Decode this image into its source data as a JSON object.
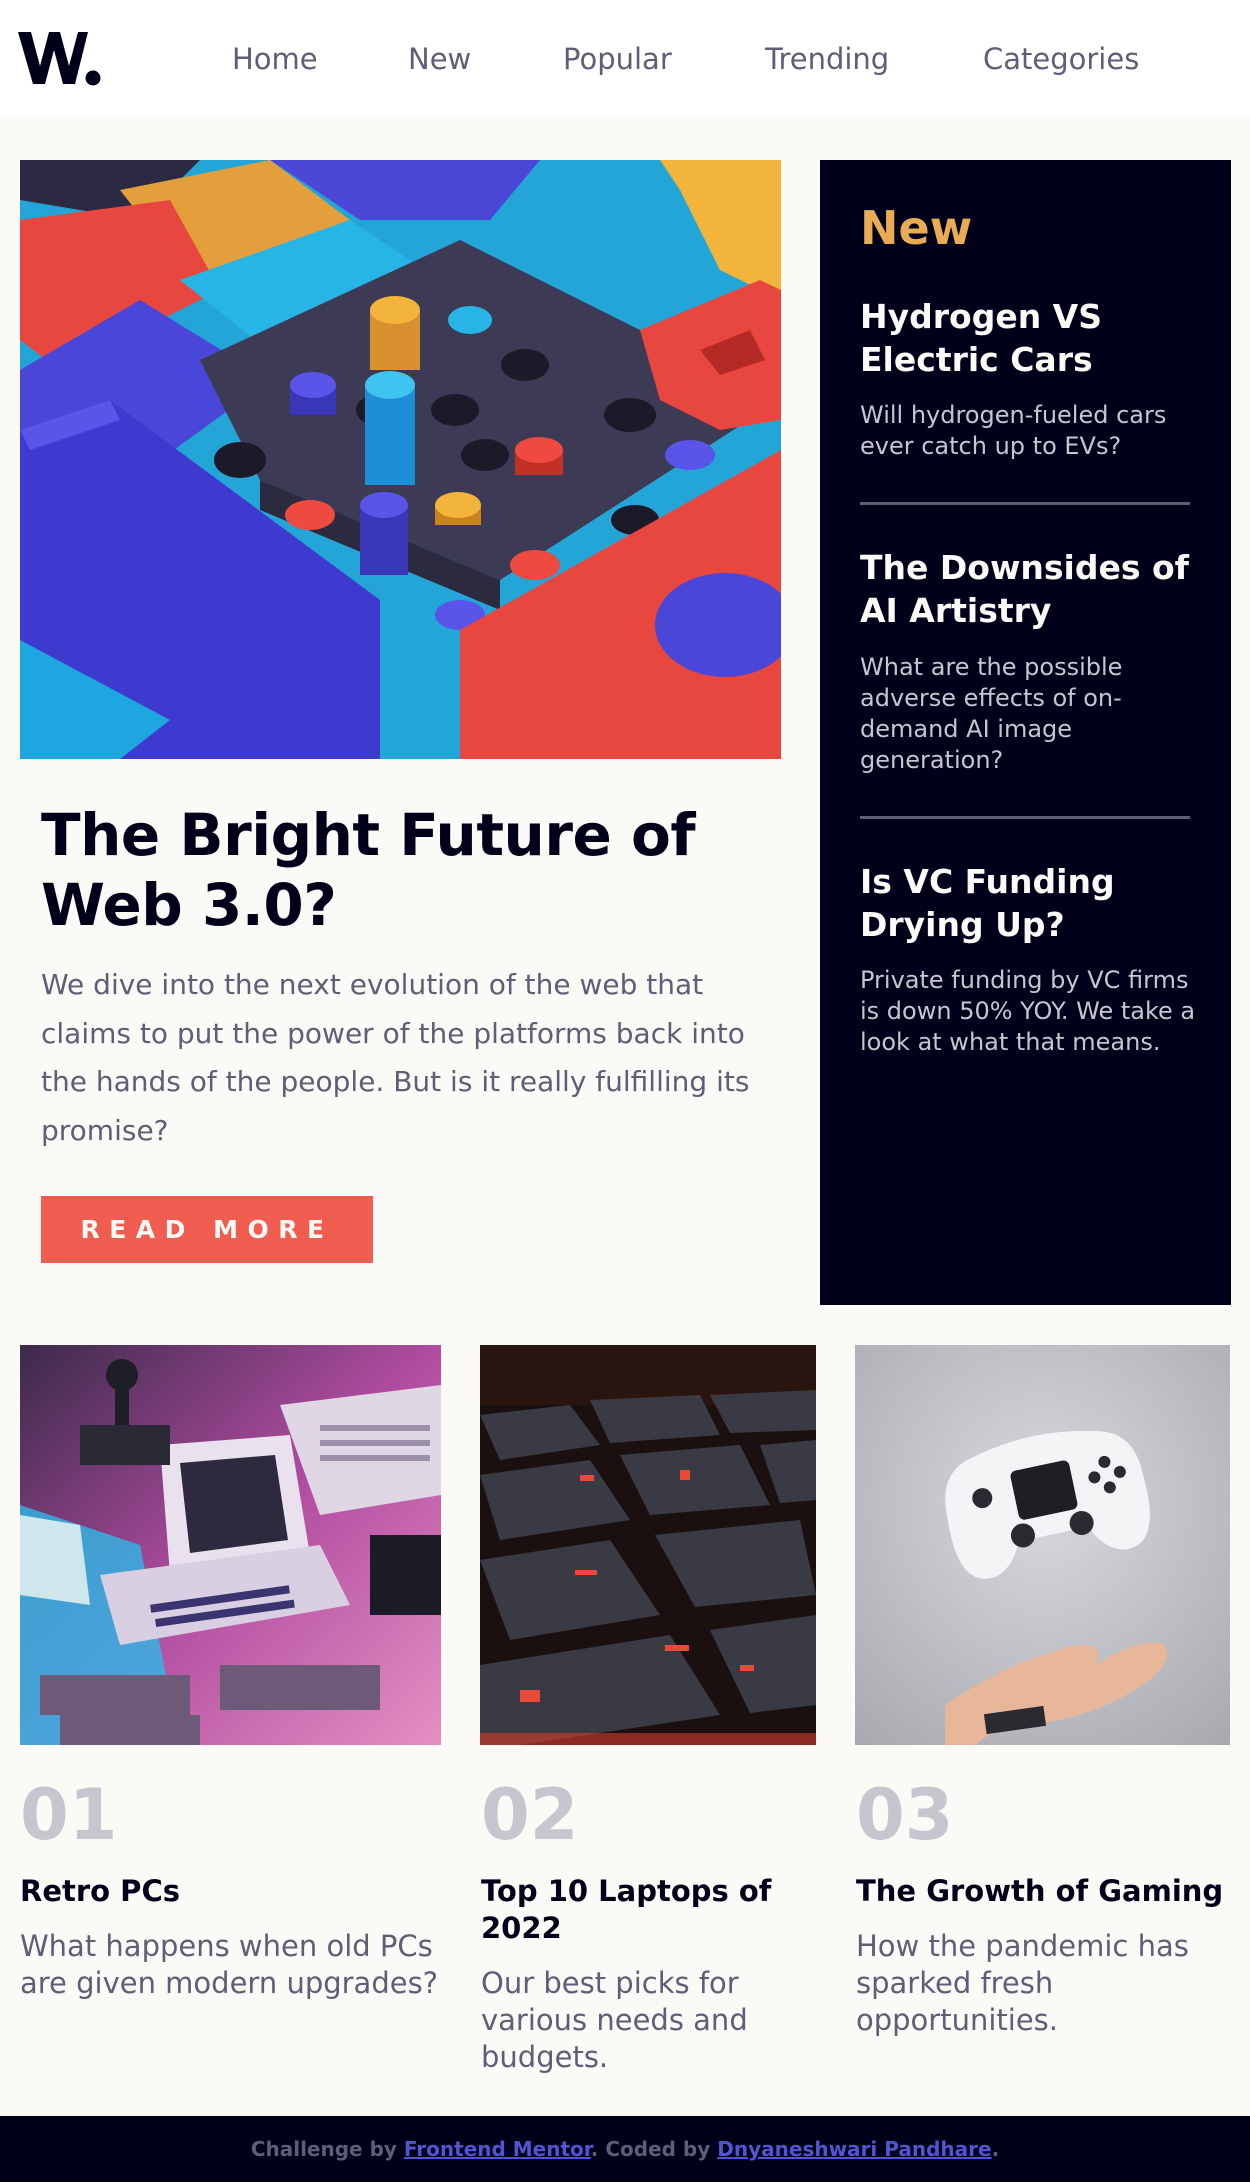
{
  "header": {
    "logo_text": "W.",
    "nav": [
      "Home",
      "New",
      "Popular",
      "Trending",
      "Categories"
    ]
  },
  "hero": {
    "image_alt": "isometric-colorful-blocks",
    "title": "The Bright Future of Web 3.0?",
    "text": "We dive into the next evolution of the web that claims to put the power of the platforms back into the hands of the people. But is it really fulfilling its promise?",
    "button_label": "READ MORE"
  },
  "new_panel": {
    "heading": "New",
    "items": [
      {
        "title": "Hydrogen VS Electric Cars",
        "text": "Will hydrogen-fueled cars ever catch up to EVs?"
      },
      {
        "title": "The Downsides of AI Artistry",
        "text": "What are the possible adverse effects of on-demand AI image generation?"
      },
      {
        "title": "Is VC Funding Drying Up?",
        "text": "Private funding by VC firms is down 50% YOY. We take a look at what that means."
      }
    ]
  },
  "cards": [
    {
      "number": "01",
      "title": "Retro PCs",
      "text": "What happens when old PCs are given modern upgrades?"
    },
    {
      "number": "02",
      "title": "Top 10 Laptops of 2022",
      "text": "Our best picks for various needs and budgets."
    },
    {
      "number": "03",
      "title": "The Growth of Gaming",
      "text": "How the pandemic has sparked fresh opportunities."
    }
  ],
  "footer": {
    "prefix": "Challenge by ",
    "link1": "Frontend Mentor",
    "middle": ". Coded by ",
    "link2": "Dnyaneshwari Pandhare",
    "suffix": "."
  },
  "colors": {
    "accent_red": "#f15d51",
    "accent_orange": "#e9ab53",
    "dark_blue": "#00001a",
    "grayish_blue": "#5d5f79",
    "off_white": "#fcfaf6"
  }
}
